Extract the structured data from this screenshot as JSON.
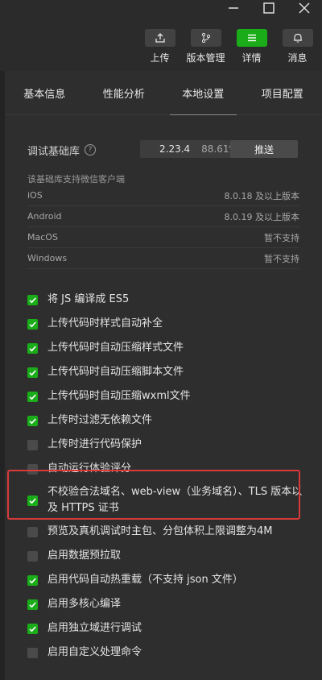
{
  "toolbar": {
    "items": [
      {
        "label": "上传",
        "icon": "upload-icon",
        "active": false
      },
      {
        "label": "版本管理",
        "icon": "branch-icon",
        "active": false
      },
      {
        "label": "详情",
        "icon": "menu-icon",
        "active": true
      },
      {
        "label": "消息",
        "icon": "bell-icon",
        "active": false
      }
    ]
  },
  "tabs": [
    {
      "label": "基本信息",
      "active": false
    },
    {
      "label": "性能分析",
      "active": false
    },
    {
      "label": "本地设置",
      "active": true
    },
    {
      "label": "项目配置",
      "active": false
    }
  ],
  "base_library": {
    "label": "调试基础库",
    "version": "2.23.4",
    "coverage": "88.61%",
    "push_label": "推送"
  },
  "support": {
    "title": "该基础库支持微信客户端",
    "rows": [
      {
        "platform": "iOS",
        "requirement": "8.0.18 及以上版本"
      },
      {
        "platform": "Android",
        "requirement": "8.0.19 及以上版本"
      },
      {
        "platform": "MacOS",
        "requirement": "暂不支持"
      },
      {
        "platform": "Windows",
        "requirement": "暂不支持"
      }
    ]
  },
  "options": [
    {
      "label": "将 JS 编译成 ES5",
      "checked": true
    },
    {
      "label": "上传代码时样式自动补全",
      "checked": true
    },
    {
      "label": "上传代码时自动压缩样式文件",
      "checked": true
    },
    {
      "label": "上传代码时自动压缩脚本文件",
      "checked": true
    },
    {
      "label": "上传代码时自动压缩wxml文件",
      "checked": true
    },
    {
      "label": "上传时过滤无依赖文件",
      "checked": true
    },
    {
      "label": "上传时进行代码保护",
      "checked": false
    },
    {
      "label": "自动运行体验评分",
      "checked": false
    },
    {
      "label": "不校验合法域名、web-view（业务域名）、TLS 版本以及 HTTPS 证书",
      "checked": true,
      "highlighted": true
    },
    {
      "label": "预览及真机调试时主包、分包体积上限调整为4M",
      "checked": false
    },
    {
      "label": "启用数据预拉取",
      "checked": false
    },
    {
      "label": "启用代码自动热重载（不支持 json 文件）",
      "checked": true
    },
    {
      "label": "启用多核心编译",
      "checked": true
    },
    {
      "label": "启用独立域进行调试",
      "checked": true
    },
    {
      "label": "启用自定义处理命令",
      "checked": false
    }
  ],
  "colors": {
    "accent": "#1aad19",
    "highlight_border": "#d83a3a",
    "background": "#2b2b2b"
  }
}
